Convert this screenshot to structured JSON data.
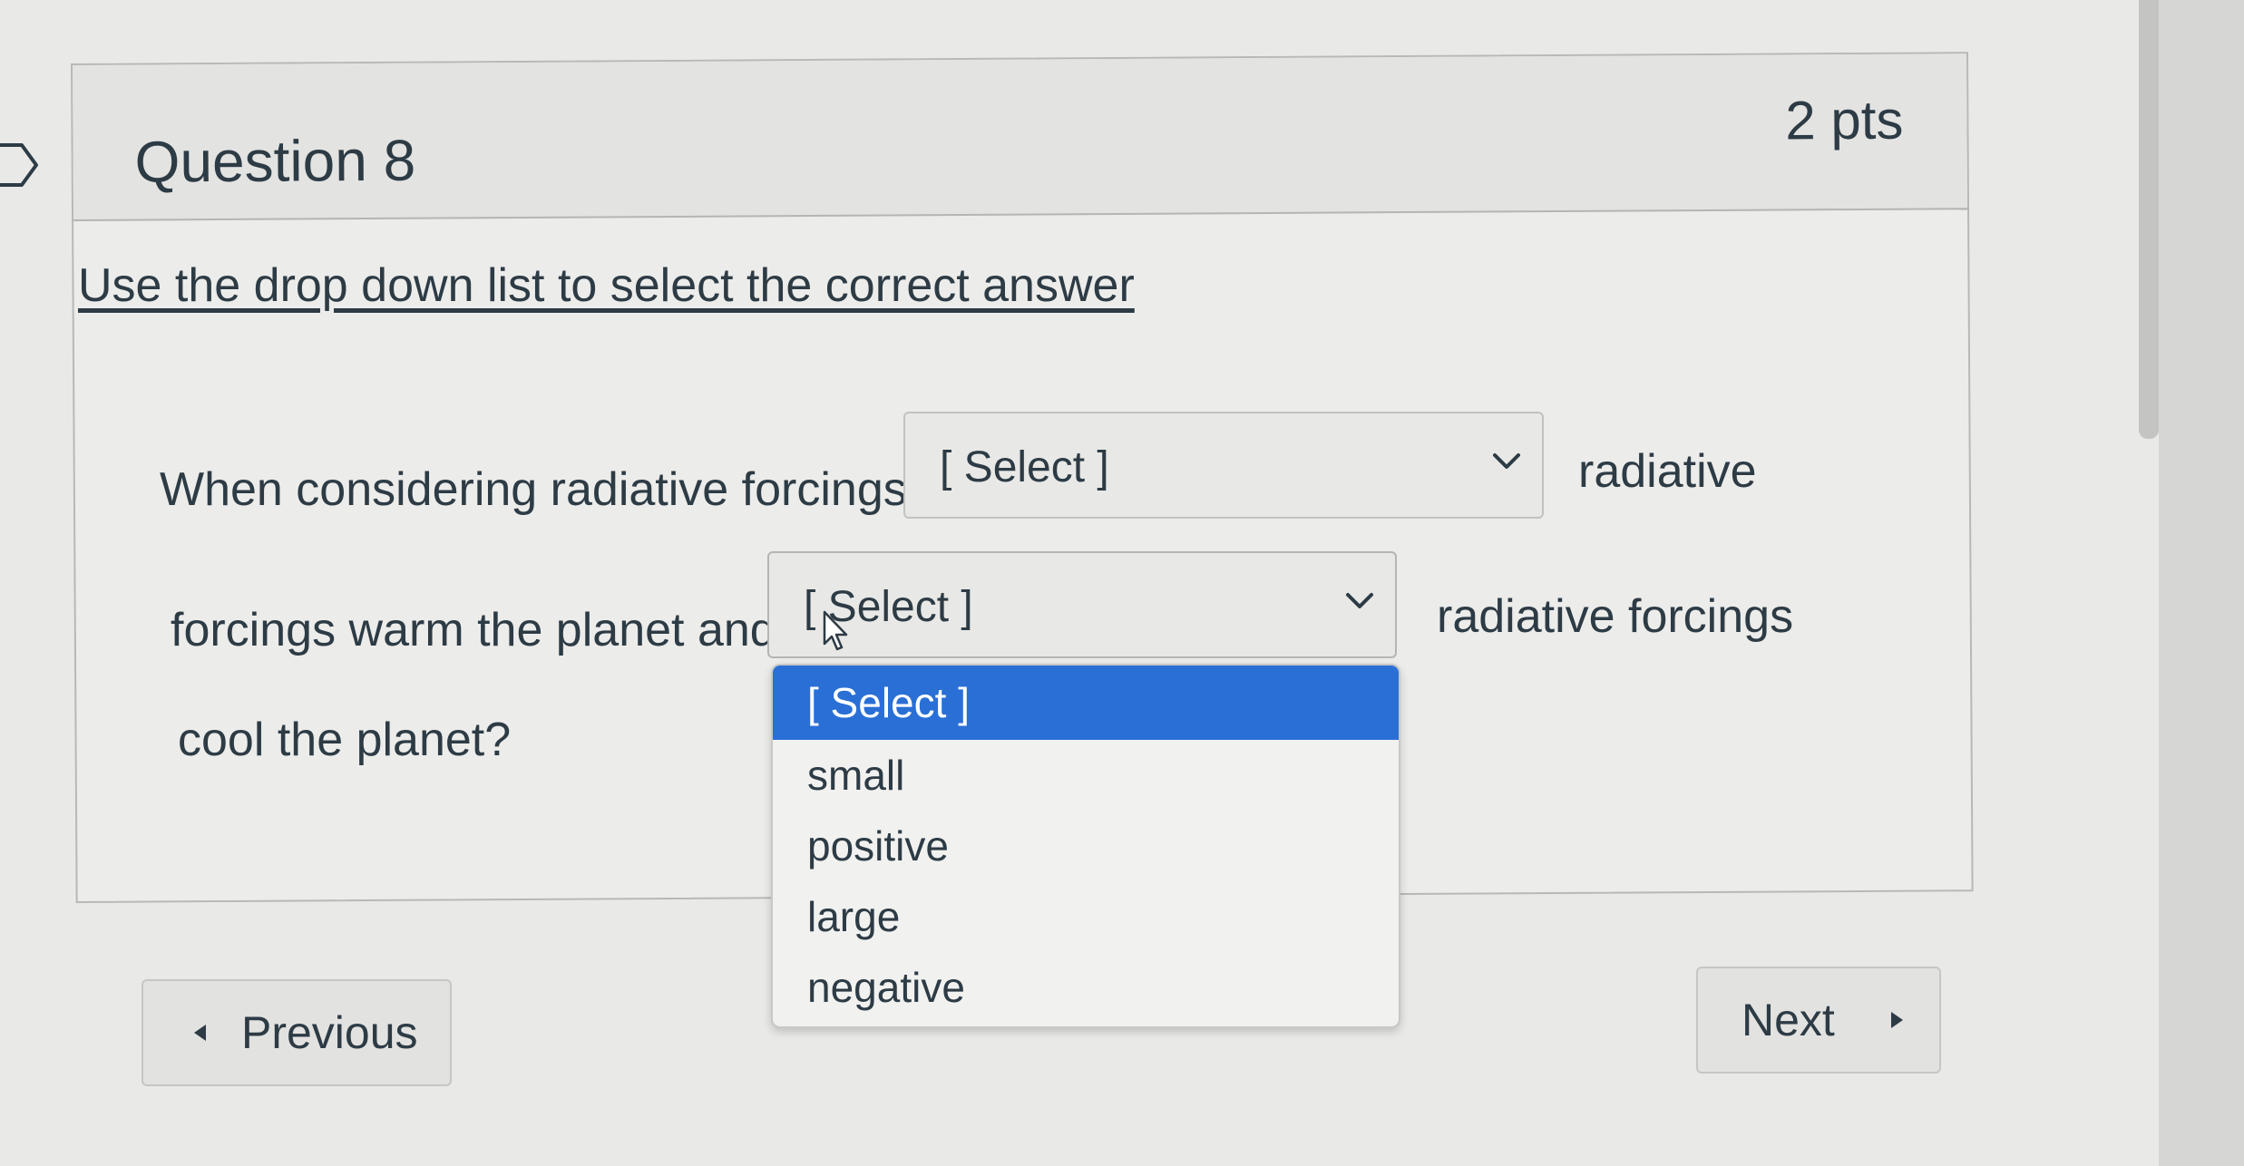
{
  "question": {
    "title": "Question 8",
    "points": "2 pts",
    "instruction": "Use the drop down list to select the correct answer",
    "text_1": "When considering radiative forcings",
    "text_2": "radiative",
    "text_3": "forcings warm the planet and",
    "text_4": "radiative forcings",
    "text_5": "cool the planet?"
  },
  "select_1": {
    "value": "[ Select ]"
  },
  "select_2": {
    "value": "[ Select ]"
  },
  "dropdown": {
    "options": [
      "[ Select ]",
      "small",
      "positive",
      "large",
      "negative"
    ],
    "highlighted": "[ Select ]"
  },
  "nav": {
    "previous_label": "Previous",
    "next_label": "Next"
  },
  "colors": {
    "highlight": "#2a6fd6",
    "text": "#2d3b45"
  }
}
